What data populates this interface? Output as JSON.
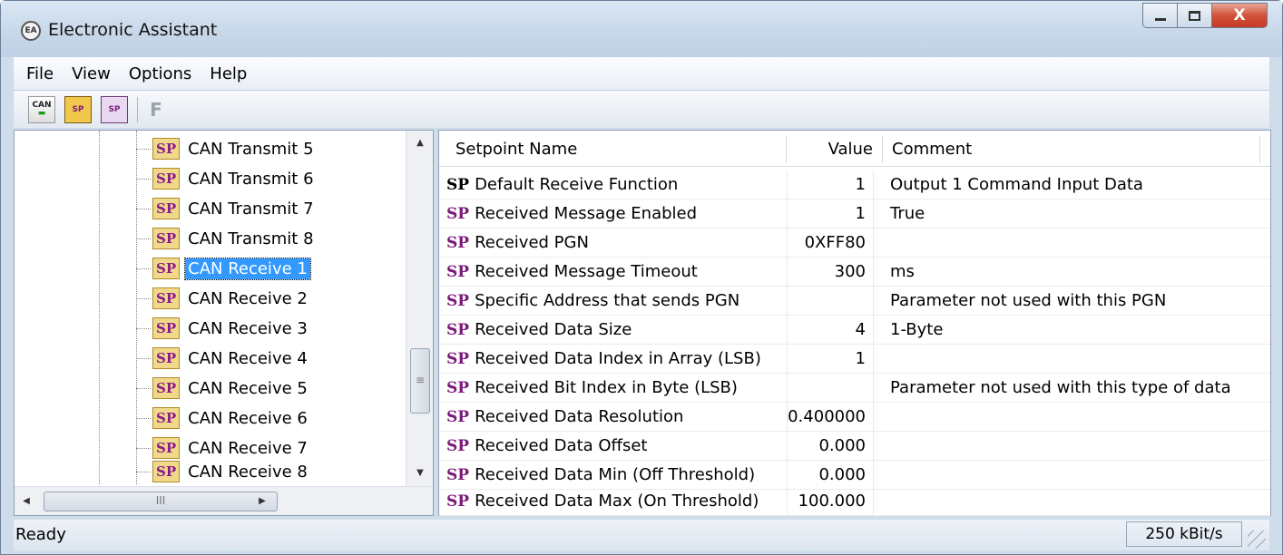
{
  "window": {
    "title": "Electronic Assistant",
    "icon": "EA",
    "close_label": "X"
  },
  "menu": [
    "File",
    "View",
    "Options",
    "Help"
  ],
  "toolbar": {
    "icons": [
      "can-connect-icon",
      "open-setpoint-icon",
      "save-setpoint-icon"
    ],
    "can_label": "CAN",
    "sp_label": "SP",
    "f_label": "F"
  },
  "tree": {
    "badge": "SP",
    "items": [
      {
        "label": "CAN Transmit 5"
      },
      {
        "label": "CAN Transmit 6"
      },
      {
        "label": "CAN Transmit 7"
      },
      {
        "label": "CAN Transmit 8"
      },
      {
        "label": "CAN Receive 1",
        "selected": true
      },
      {
        "label": "CAN Receive 2"
      },
      {
        "label": "CAN Receive 3"
      },
      {
        "label": "CAN Receive 4"
      },
      {
        "label": "CAN Receive 5"
      },
      {
        "label": "CAN Receive 6"
      },
      {
        "label": "CAN Receive 7"
      },
      {
        "label": "CAN Receive 8"
      }
    ],
    "hscroll_thumb": "III",
    "vscroll_thumb": "≡"
  },
  "grid": {
    "columns": [
      "Setpoint Name",
      "Value",
      "Comment"
    ],
    "sp_mark": "SP",
    "rows": [
      {
        "name": "Default Receive Function",
        "value": "1",
        "comment": "Output 1 Command Input Data"
      },
      {
        "name": "Received Message Enabled",
        "value": "1",
        "comment": "True"
      },
      {
        "name": "Received PGN",
        "value": "0XFF80",
        "comment": ""
      },
      {
        "name": "Received Message Timeout",
        "value": "300",
        "comment": "ms"
      },
      {
        "name": "Specific Address that sends PGN",
        "value": "",
        "comment": "Parameter not used with this PGN"
      },
      {
        "name": "Received Data Size",
        "value": "4",
        "comment": "1-Byte"
      },
      {
        "name": "Received Data Index in Array (LSB)",
        "value": "1",
        "comment": ""
      },
      {
        "name": "Received Bit Index in Byte (LSB)",
        "value": "",
        "comment": "Parameter not used with this type of data"
      },
      {
        "name": "Received Data Resolution",
        "value": "0.400000",
        "comment": ""
      },
      {
        "name": "Received Data Offset",
        "value": "0.000",
        "comment": ""
      },
      {
        "name": "Received Data Min (Off Threshold)",
        "value": "0.000",
        "comment": ""
      },
      {
        "name": "Received Data Max (On Threshold)",
        "value": "100.000",
        "comment": ""
      }
    ]
  },
  "status": {
    "text": "Ready",
    "baud": "250 kBit/s"
  }
}
